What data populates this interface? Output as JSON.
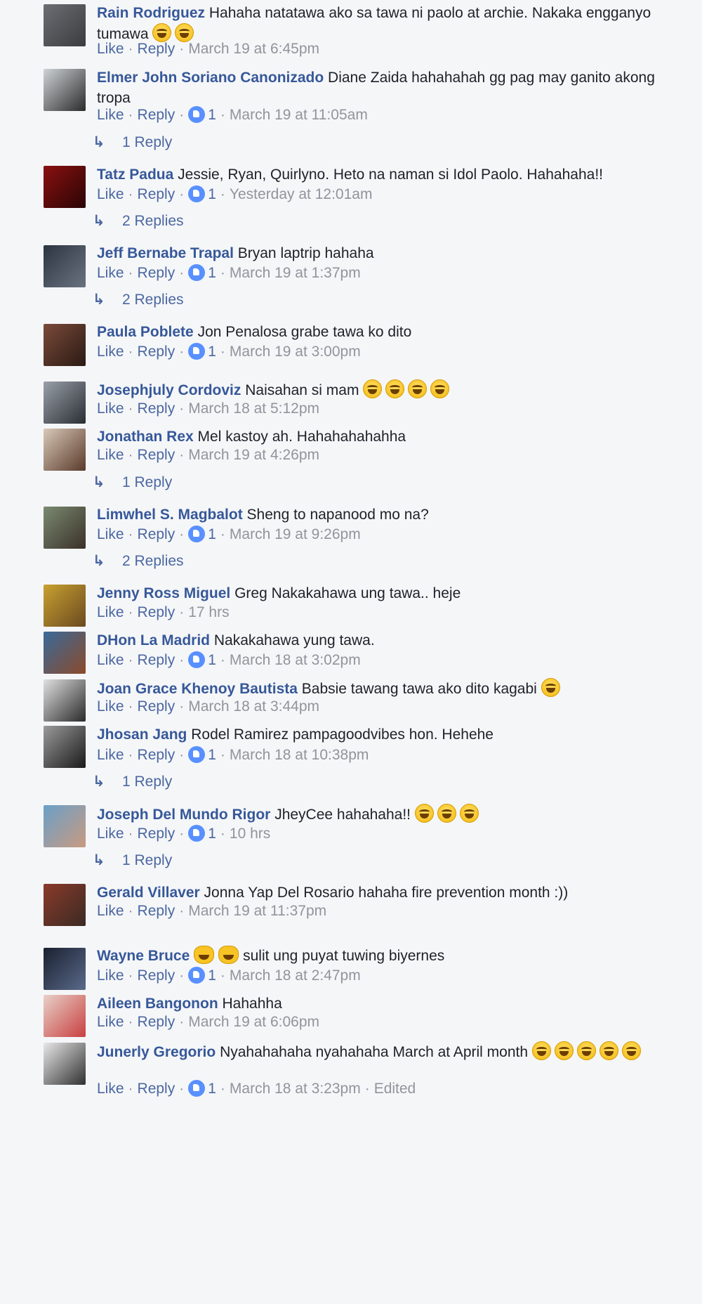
{
  "labels": {
    "like": "Like",
    "reply": "Reply"
  },
  "comments": [
    {
      "author": "Rain Rodriguez",
      "text": "Hahaha natatawa ako sa tawa ni paolo at archie. Nakaka engganyo tumawa",
      "emoji_count": 2,
      "likes": null,
      "time": "March 19 at 6:45pm",
      "replies": null,
      "avatar_colors": [
        "#6b6e72",
        "#3a3c40"
      ]
    },
    {
      "author": "Elmer John Soriano Canonizado",
      "text": "Diane Zaida hahahahah gg pag may ganito akong tropa",
      "emoji_count": 0,
      "likes": "1",
      "time": "March 19 at 11:05am",
      "replies": "1 Reply",
      "avatar_colors": [
        "#cfd3d6",
        "#2b2b2b"
      ]
    },
    {
      "author": "Tatz Padua",
      "text": "Jessie, Ryan, Quirlyno. Heto na naman si Idol Paolo. Hahahaha!!",
      "emoji_count": 0,
      "likes": "1",
      "time": "Yesterday at 12:01am",
      "replies": "2 Replies",
      "avatar_colors": [
        "#8a1010",
        "#2a0505"
      ]
    },
    {
      "author": "Jeff Bernabe Trapal",
      "text": "Bryan laptrip hahaha",
      "emoji_count": 0,
      "likes": "1",
      "time": "March 19 at 1:37pm",
      "replies": "2 Replies",
      "avatar_colors": [
        "#2c3440",
        "#6a7480"
      ]
    },
    {
      "author": "Paula Poblete",
      "text": "Jon Penalosa grabe tawa ko dito",
      "emoji_count": 0,
      "likes": "1",
      "time": "March 19 at 3:00pm",
      "replies": null,
      "avatar_colors": [
        "#7a4a3a",
        "#2a1a14"
      ]
    },
    {
      "author": "Josephjuly Cordoviz",
      "text": "Naisahan si mam",
      "emoji_count": 4,
      "likes": null,
      "time": "March 18 at 5:12pm",
      "replies": null,
      "avatar_colors": [
        "#9aa0a8",
        "#2a2e34"
      ]
    },
    {
      "author": "Jonathan Rex",
      "text": "Mel kastoy ah. Hahahahahahha",
      "emoji_count": 0,
      "likes": null,
      "time": "March 19 at 4:26pm",
      "replies": "1 Reply",
      "avatar_colors": [
        "#d8c8b8",
        "#5a3a2a"
      ]
    },
    {
      "author": "Limwhel S. Magbalot",
      "text": "Sheng to napanood mo na?",
      "emoji_count": 0,
      "likes": "1",
      "time": "March 19 at 9:26pm",
      "replies": "2 Replies",
      "avatar_colors": [
        "#7a8a70",
        "#3a3028"
      ]
    },
    {
      "author": "Jenny Ross Miguel",
      "text": "Greg Nakakahawa ung tawa.. heje",
      "emoji_count": 0,
      "likes": null,
      "time": "17 hrs",
      "replies": null,
      "avatar_colors": [
        "#c9a030",
        "#6a4a20"
      ]
    },
    {
      "author": "DHon La Madrid",
      "text": "Nakakahawa yung tawa.",
      "emoji_count": 0,
      "likes": "1",
      "time": "March 18 at 3:02pm",
      "replies": null,
      "avatar_colors": [
        "#3a6a9a",
        "#8a4a2a"
      ]
    },
    {
      "author": "Joan Grace Khenoy Bautista",
      "text": "Babsie tawang tawa ako dito kagabi",
      "emoji_count": 1,
      "likes": null,
      "time": "March 18 at 3:44pm",
      "replies": null,
      "avatar_colors": [
        "#e0e0e0",
        "#2a2a2a"
      ]
    },
    {
      "author": "Jhosan Jang",
      "text": "Rodel Ramirez pampagoodvibes hon. Hehehe",
      "emoji_count": 0,
      "likes": "1",
      "time": "March 18 at 10:38pm",
      "replies": "1 Reply",
      "avatar_colors": [
        "#9a9a9a",
        "#1a1a1a"
      ]
    },
    {
      "author": "Joseph Del Mundo Rigor",
      "text": "JheyCee hahahaha!!",
      "emoji_count": 3,
      "likes": "1",
      "time": "10 hrs",
      "replies": "1 Reply",
      "avatar_colors": [
        "#6aa0c8",
        "#c89a80"
      ]
    },
    {
      "author": "Gerald Villaver",
      "text": "Jonna Yap Del Rosario hahaha fire prevention month :))",
      "emoji_count": 0,
      "likes": null,
      "time": "March 19 at 11:37pm",
      "replies": null,
      "avatar_colors": [
        "#8a3a2a",
        "#3a2a24"
      ]
    },
    {
      "author": "Wayne Bruce",
      "text": "sulit ung puyat tuwing biyernes",
      "emoji_count": 0,
      "cat_emoji_count": 2,
      "likes": "1",
      "time": "March 18 at 2:47pm",
      "replies": null,
      "avatar_colors": [
        "#1a2030",
        "#5a6a8a"
      ]
    },
    {
      "author": "Aileen Bangonon",
      "text": "Hahahha",
      "emoji_count": 0,
      "likes": null,
      "time": "March 19 at 6:06pm",
      "replies": null,
      "avatar_colors": [
        "#e8d0c8",
        "#c84040"
      ]
    },
    {
      "author": "Junerly Gregorio",
      "text": "Nyahahahaha nyahahaha March at April month",
      "emoji_count": 5,
      "likes": "1",
      "time": "March 18 at 3:23pm",
      "edited": "Edited",
      "replies": null,
      "avatar_colors": [
        "#e8e8e8",
        "#303030"
      ]
    }
  ]
}
